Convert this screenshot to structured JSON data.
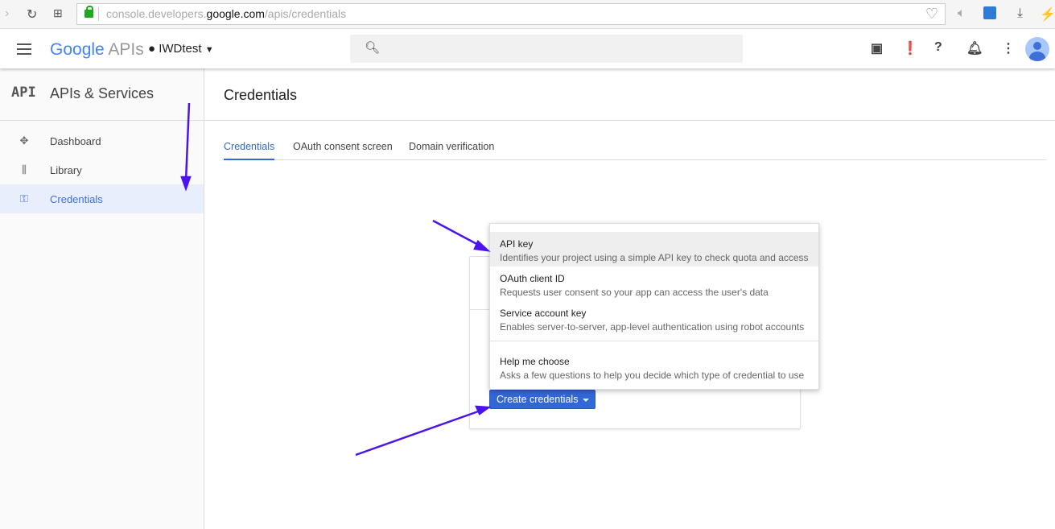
{
  "browser": {
    "url_prefix": "console.developers.",
    "url_domain": "google.com",
    "url_path": "/apis/credentials"
  },
  "appbar": {
    "logo_google": "Google",
    "logo_apis": "APIs",
    "project": "IWDtest"
  },
  "sidebar": {
    "icon_text": "API",
    "title": "APIs & Services",
    "items": [
      {
        "label": "Dashboard",
        "icon": "dashboard-icon"
      },
      {
        "label": "Library",
        "icon": "library-icon"
      },
      {
        "label": "Credentials",
        "icon": "key-icon",
        "active": true
      }
    ]
  },
  "main": {
    "title": "Credentials",
    "tabs": [
      {
        "label": "Credentials",
        "active": true
      },
      {
        "label": "OAuth consent screen"
      },
      {
        "label": "Domain verification"
      }
    ],
    "create_button": "Create credentials",
    "menu": [
      {
        "title": "API key",
        "desc": "Identifies your project using a simple API key to check quota and access"
      },
      {
        "title": "OAuth client ID",
        "desc": "Requests user consent so your app can access the user's data"
      },
      {
        "title": "Service account key",
        "desc": "Enables server-to-server, app-level authentication using robot accounts"
      },
      {
        "title": "Help me choose",
        "desc": "Asks a few questions to help you decide which type of credential to use"
      }
    ]
  },
  "colors": {
    "accent": "#3367d6",
    "annotation_arrow": "#4a14f0"
  }
}
